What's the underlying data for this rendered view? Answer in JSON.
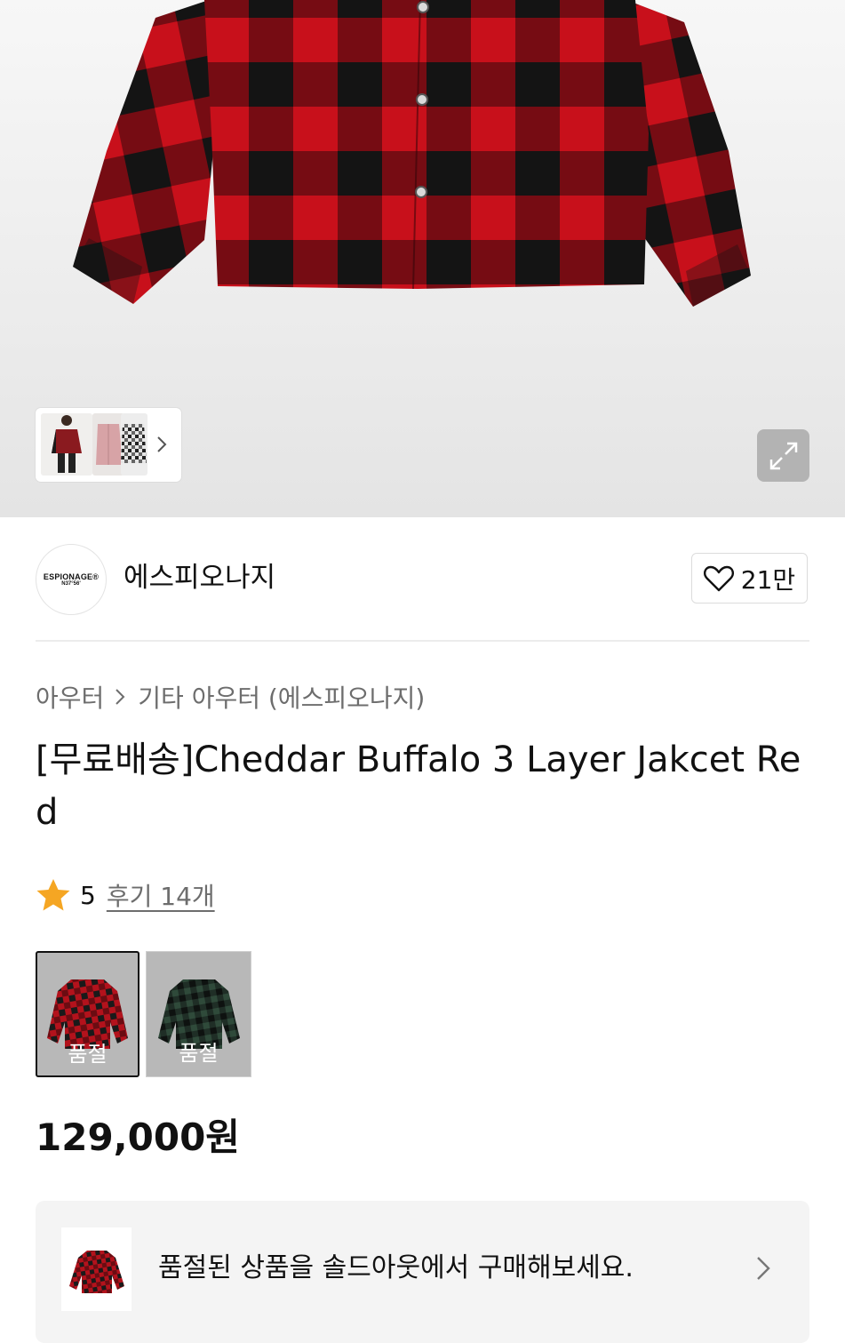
{
  "gallery": {
    "main_image": "red-black-buffalo-check-jacket",
    "thumbnails": [
      "model-wearing-red-jacket",
      "pink-shirt",
      "black-white-check-jacket"
    ],
    "next_icon": "chevron-right-icon",
    "zoom_icon": "expand-icon"
  },
  "brand": {
    "logo_line1": "ESPIONAGE®",
    "logo_line2": "N37°56'",
    "name": "에스피오나지",
    "likes": "21만"
  },
  "breadcrumb": {
    "category": "아우터",
    "subcategory": "기타 아우터 (에스피오나지)"
  },
  "product": {
    "title": "[무료배송]Cheddar Buffalo 3 Layer Jakcet Red",
    "rating": "5",
    "reviews": "후기 14개",
    "price": "129,000원"
  },
  "options": [
    {
      "image": "red-check-jacket",
      "status": "품절",
      "selected": true
    },
    {
      "image": "green-check-jacket",
      "status": "품절",
      "selected": false
    }
  ],
  "soldout_banner": {
    "text": "품절된 상품을 솔드아웃에서 구매해보세요."
  },
  "colors": {
    "star": "#f5a623",
    "plaid_red": "#c8101b",
    "plaid_black": "#141414",
    "banner_bg": "#f4f4f4"
  }
}
